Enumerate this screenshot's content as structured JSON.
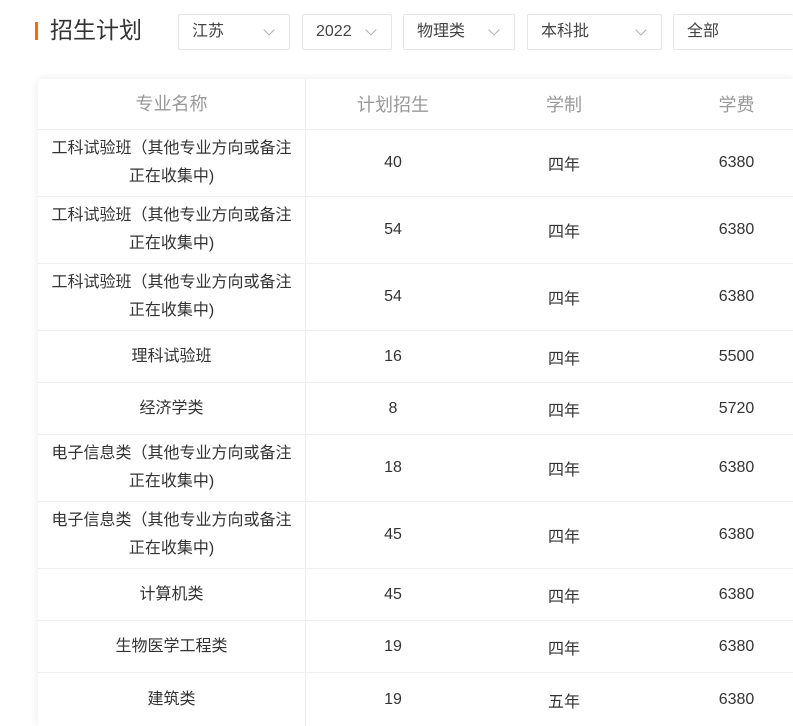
{
  "header": {
    "title": "招生计划"
  },
  "colors": {
    "accent": "#ff6a00",
    "header_text": "#999999",
    "body_text": "#333333"
  },
  "filters": [
    {
      "value": "江苏",
      "icon": "chevron-down-icon"
    },
    {
      "value": "2022",
      "icon": "chevron-down-icon"
    },
    {
      "value": "物理类",
      "icon": "chevron-down-icon"
    },
    {
      "value": "本科批",
      "icon": "chevron-down-icon"
    },
    {
      "value": "全部"
    }
  ],
  "table": {
    "columns": [
      "专业名称",
      "计划招生",
      "学制",
      "学费"
    ],
    "rows": [
      {
        "major": "工科试验班（其他专业方向或备注\n正在收集中)",
        "plan": "40",
        "duration": "四年",
        "fee": "6380"
      },
      {
        "major": "工科试验班（其他专业方向或备注\n正在收集中)",
        "plan": "54",
        "duration": "四年",
        "fee": "6380"
      },
      {
        "major": "工科试验班（其他专业方向或备注\n正在收集中)",
        "plan": "54",
        "duration": "四年",
        "fee": "6380"
      },
      {
        "major": "理科试验班",
        "plan": "16",
        "duration": "四年",
        "fee": "5500"
      },
      {
        "major": "经济学类",
        "plan": "8",
        "duration": "四年",
        "fee": "5720"
      },
      {
        "major": "电子信息类（其他专业方向或备注\n正在收集中)",
        "plan": "18",
        "duration": "四年",
        "fee": "6380"
      },
      {
        "major": "电子信息类（其他专业方向或备注\n正在收集中)",
        "plan": "45",
        "duration": "四年",
        "fee": "6380"
      },
      {
        "major": "计算机类",
        "plan": "45",
        "duration": "四年",
        "fee": "6380"
      },
      {
        "major": "生物医学工程类",
        "plan": "19",
        "duration": "四年",
        "fee": "6380"
      },
      {
        "major": "建筑类",
        "plan": "19",
        "duration": "五年",
        "fee": "6380"
      }
    ]
  }
}
